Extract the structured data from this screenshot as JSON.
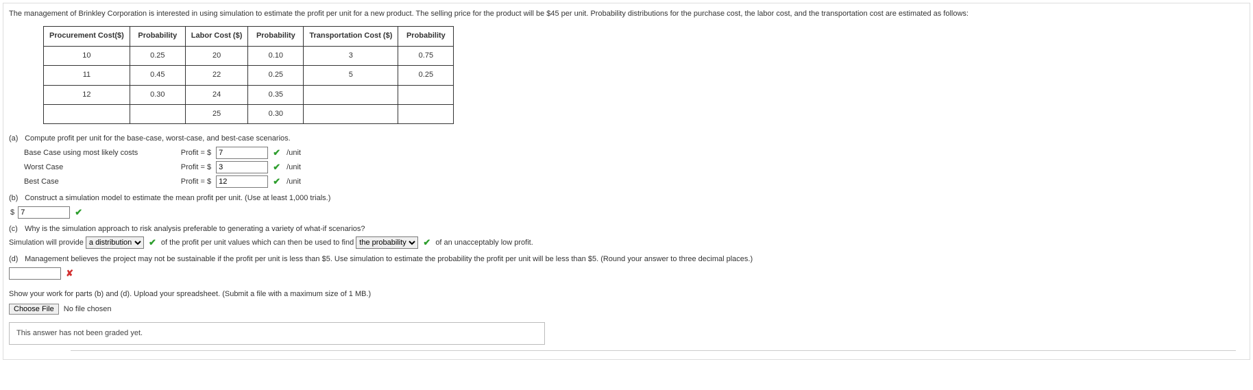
{
  "intro": "The management of Brinkley Corporation is interested in using simulation to estimate the profit per unit for a new product. The selling price for the product will be $45 per unit. Probability distributions for the purchase cost, the labor cost, and the transportation cost are estimated as follows:",
  "table": {
    "headers": [
      "Procurement Cost($)",
      "Probability",
      "Labor Cost ($)",
      "Probability",
      "Transportation Cost ($)",
      "Probability"
    ],
    "rows": [
      [
        "10",
        "0.25",
        "20",
        "0.10",
        "3",
        "0.75"
      ],
      [
        "11",
        "0.45",
        "22",
        "0.25",
        "5",
        "0.25"
      ],
      [
        "12",
        "0.30",
        "24",
        "0.35",
        "",
        ""
      ],
      [
        "",
        "",
        "25",
        "0.30",
        "",
        ""
      ]
    ]
  },
  "partA": {
    "label": "(a)",
    "prompt": "Compute profit per unit for the base-case, worst-case, and best-case scenarios.",
    "lines": [
      {
        "scenario": "Base Case using most likely costs",
        "profit_label": "Profit  =  $",
        "value": "7",
        "unit": "/unit",
        "status": "check"
      },
      {
        "scenario": "Worst Case",
        "profit_label": "Profit  =  $",
        "value": "3",
        "unit": "/unit",
        "status": "check"
      },
      {
        "scenario": "Best Case",
        "profit_label": "Profit  =  $",
        "value": "12",
        "unit": "/unit",
        "status": "check"
      }
    ]
  },
  "partB": {
    "label": "(b)",
    "prompt": "Construct a simulation model to estimate the mean profit per unit. (Use at least 1,000 trials.)",
    "dollar": "$",
    "value": "7",
    "status": "check"
  },
  "partC": {
    "label": "(c)",
    "prompt": "Why is the simulation approach to risk analysis preferable to generating a variety of what-if scenarios?",
    "pre": "Simulation will provide",
    "sel1": {
      "value": "a distribution",
      "options": [
        "a distribution"
      ]
    },
    "mid": "of the profit per unit values which can then be used to find",
    "sel2": {
      "value": "the probability",
      "options": [
        "the probability"
      ]
    },
    "post": "of an unacceptably low profit.",
    "status": "check"
  },
  "partD": {
    "label": "(d)",
    "prompt": "Management believes the project may not be sustainable if the profit per unit is less than $5. Use simulation to estimate the probability the profit per unit will be less than $5. (Round your answer to three decimal places.)",
    "value": "",
    "status": "wrong"
  },
  "upload": {
    "prompt": "Show your work for parts (b) and (d). Upload your spreadsheet. (Submit a file with a maximum size of 1 MB.)",
    "button": "Choose File",
    "status": "No file chosen",
    "graded": "This answer has not been graded yet."
  }
}
